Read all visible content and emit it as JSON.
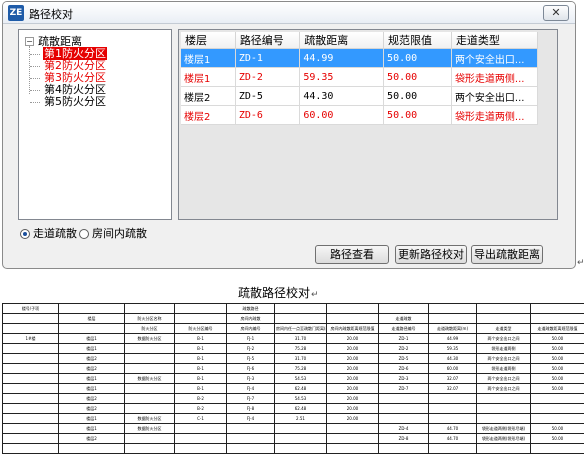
{
  "window": {
    "title": "路径校对",
    "icon_letter": "ZE",
    "close_label": "✕"
  },
  "tree": {
    "root": "疏散距离",
    "expander": "−",
    "items": [
      {
        "label": "第1防火分区",
        "state": "selected"
      },
      {
        "label": "第2防火分区",
        "state": "red"
      },
      {
        "label": "第3防火分区",
        "state": "red"
      },
      {
        "label": "第4防火分区",
        "state": "normal"
      },
      {
        "label": "第5防火分区",
        "state": "normal"
      }
    ]
  },
  "grid": {
    "columns": [
      "楼层",
      "路径编号",
      "疏散距离",
      "规范限值",
      "走道类型"
    ],
    "rows": [
      {
        "cells": [
          "楼层1",
          "ZD-1",
          "44.99",
          "50.00",
          "两个安全出口..."
        ],
        "state": "selected"
      },
      {
        "cells": [
          "楼层1",
          "ZD-2",
          "59.35",
          "50.00",
          "袋形走道两侧..."
        ],
        "state": "red"
      },
      {
        "cells": [
          "楼层2",
          "ZD-5",
          "44.30",
          "50.00",
          "两个安全出口..."
        ],
        "state": "normal"
      },
      {
        "cells": [
          "楼层2",
          "ZD-6",
          "60.00",
          "50.00",
          "袋形走道两侧..."
        ],
        "state": "red"
      }
    ]
  },
  "options": {
    "radio1": "走道疏散",
    "radio2": "房间内疏散",
    "selected": "radio1"
  },
  "buttons": {
    "view_path": "路径查看",
    "update_path": "更新路径校对",
    "export": "导出疏散距离"
  },
  "caption": "疏散路径校对",
  "return_mark": "↵",
  "spec_table": {
    "rows": [
      [
        "楼号/子项",
        "",
        "",
        "",
        "疏散路径",
        "",
        "",
        "",
        "",
        "",
        "",
        ""
      ],
      [
        "",
        "楼层",
        "防火分区名称",
        "",
        "房间内疏散",
        "",
        "",
        "走道疏散",
        "",
        "",
        "",
        ""
      ],
      [
        "",
        "",
        "防火分区",
        "防火分区编号",
        "房间内编号",
        "房间内任一点至疏散门距离(m)",
        "房间内疏散距离规范限值",
        "走道路径编号",
        "走道疏散距离(m)",
        "走道类型",
        "走道疏散距离规范限值",
        ""
      ],
      [
        "1#楼",
        "楼层1",
        "数据防火分区",
        "B-1",
        "FJ-1",
        "31.70",
        "20.00",
        "ZD-1",
        "44.99",
        "两个安全出口之间",
        "50.00",
        ""
      ],
      [
        "",
        "楼层1",
        "",
        "B-1",
        "FJ-2",
        "75.28",
        "20.00",
        "ZD-2",
        "59.35",
        "袋形走道两侧",
        "50.00",
        ""
      ],
      [
        "",
        "楼层2",
        "",
        "B-1",
        "FJ-5",
        "31.70",
        "20.00",
        "ZD-5",
        "44.30",
        "两个安全出口之间",
        "50.00",
        ""
      ],
      [
        "",
        "楼层2",
        "",
        "B-1",
        "FJ-6",
        "75.28",
        "20.00",
        "ZD-6",
        "60.00",
        "袋形走道两侧",
        "50.00",
        ""
      ],
      [
        "",
        "楼层1",
        "数据防火分区",
        "B-1",
        "FJ-3",
        "54.53",
        "20.00",
        "ZD-3",
        "32.07",
        "两个安全出口之间",
        "50.00",
        ""
      ],
      [
        "",
        "楼层1",
        "",
        "B-1",
        "FJ-4",
        "62.48",
        "20.00",
        "ZD-7",
        "32.07",
        "两个安全出口之间",
        "50.00",
        ""
      ],
      [
        "",
        "楼层2",
        "",
        "B-2",
        "FJ-7",
        "54.53",
        "20.00",
        "",
        "",
        "",
        "",
        ""
      ],
      [
        "",
        "楼层2",
        "",
        "B-2",
        "FJ-8",
        "62.48",
        "20.00",
        "",
        "",
        "",
        "",
        ""
      ],
      [
        "",
        "楼层1",
        "数据防火分区",
        "C-1",
        "FJ-4",
        "2.51",
        "20.00",
        "",
        "",
        "",
        "",
        ""
      ],
      [
        "",
        "楼层1",
        "数据防火分区",
        "",
        "",
        "",
        "",
        "ZD-4",
        "44.70",
        "袋形走道两侧(袋形尽端)",
        "50.00",
        ""
      ],
      [
        "",
        "楼层2",
        "",
        "",
        "",
        "",
        "",
        "ZD-8",
        "44.70",
        "袋形走道两侧(袋形尽端)",
        "50.00",
        ""
      ],
      [
        "",
        "",
        "",
        "",
        "",
        "",
        "",
        "",
        "",
        "",
        "",
        ""
      ]
    ]
  }
}
